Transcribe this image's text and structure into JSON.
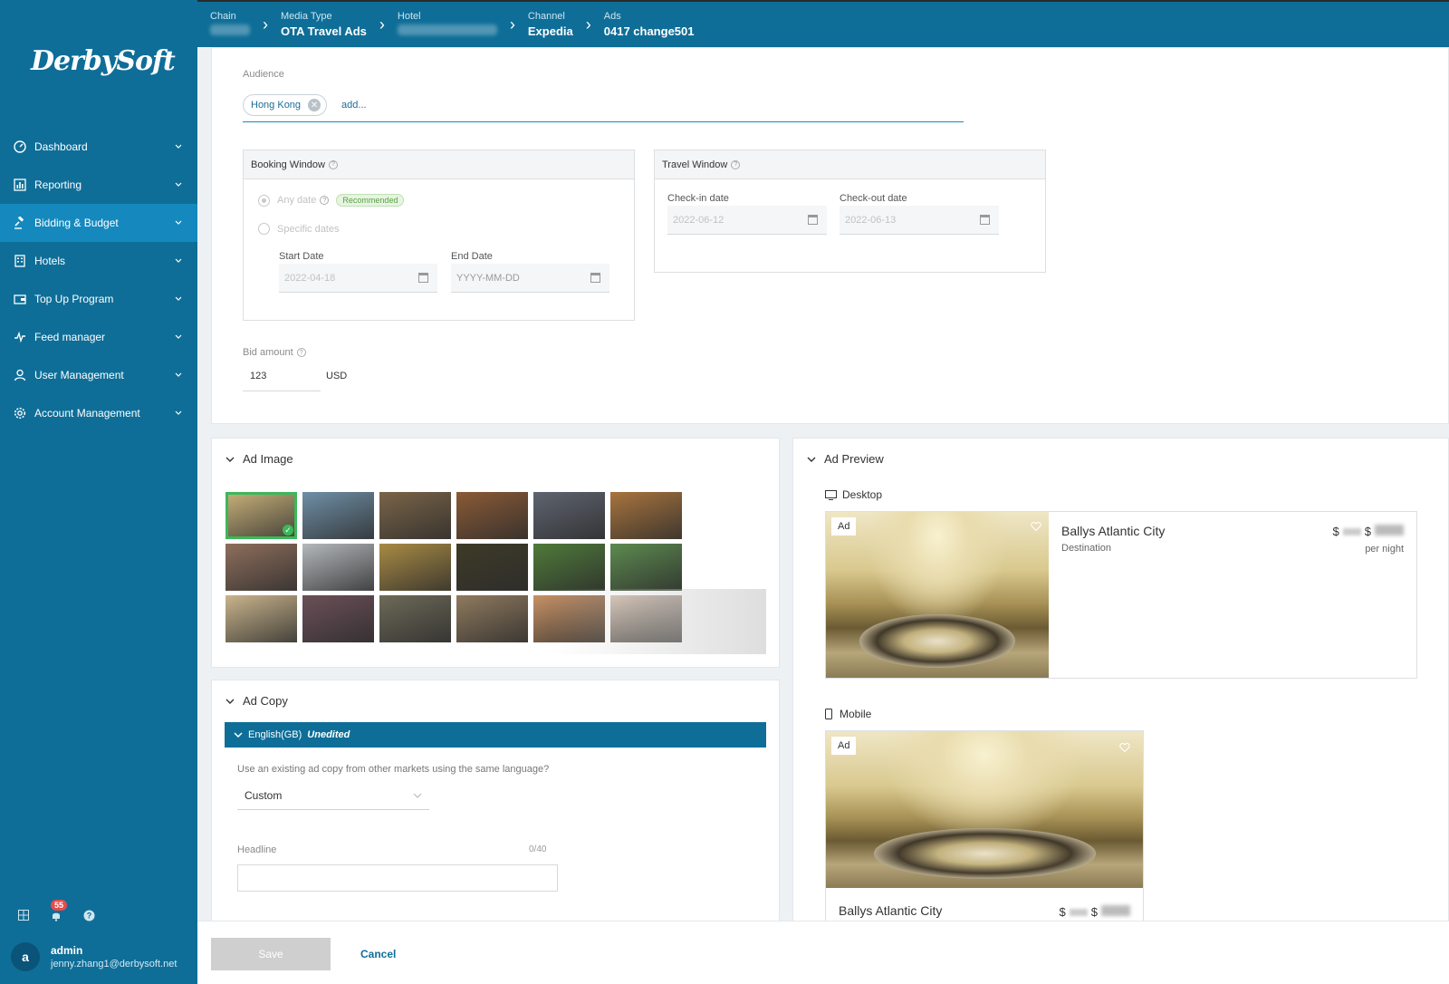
{
  "app": {
    "logo_text": "DerbySoft"
  },
  "sidebar": {
    "items": [
      {
        "label": "Dashboard",
        "icon": "dashboard-icon"
      },
      {
        "label": "Reporting",
        "icon": "chart-icon"
      },
      {
        "label": "Bidding & Budget",
        "icon": "gavel-icon",
        "active": true
      },
      {
        "label": "Hotels",
        "icon": "building-icon"
      },
      {
        "label": "Top Up Program",
        "icon": "wallet-icon"
      },
      {
        "label": "Feed manager",
        "icon": "pulse-icon"
      },
      {
        "label": "User Management",
        "icon": "user-icon"
      },
      {
        "label": "Account Management",
        "icon": "gear-icon"
      }
    ],
    "notification_count": "55",
    "user": {
      "initial": "a",
      "name": "admin",
      "email": "jenny.zhang1@derbysoft.net"
    }
  },
  "breadcrumb": [
    {
      "key": "Chain",
      "value": ""
    },
    {
      "key": "Media Type",
      "value": "OTA Travel Ads"
    },
    {
      "key": "Hotel",
      "value": ""
    },
    {
      "key": "Channel",
      "value": "Expedia"
    },
    {
      "key": "Ads",
      "value": "0417 change501"
    }
  ],
  "audience": {
    "label": "Audience",
    "chip": "Hong Kong",
    "add_placeholder": "add..."
  },
  "booking_window": {
    "title": "Booking Window",
    "any_date": "Any date",
    "recommended": "Recommended",
    "specific_dates": "Specific dates",
    "start_label": "Start Date",
    "start_value": "2022-04-18",
    "end_label": "End Date",
    "end_placeholder": "YYYY-MM-DD"
  },
  "travel_window": {
    "title": "Travel Window",
    "checkin_label": "Check-in date",
    "checkin_value": "2022-06-12",
    "checkout_label": "Check-out date",
    "checkout_value": "2022-06-13"
  },
  "bid": {
    "label": "Bid amount",
    "value": "123",
    "currency": "USD"
  },
  "ad_image": {
    "title": "Ad Image",
    "thumbnail_colors": [
      "#c9b27a",
      "#6f8fa6",
      "#7a6448",
      "#8a5a36",
      "#5f6470",
      "#a8743e",
      "#8e6e5c",
      "#b4b8bb",
      "#a88a44",
      "#3e3a28",
      "#4f7a3a",
      "#5d8a50",
      "#c9b48c",
      "#6b5058",
      "#6d6a58",
      "#8f7a5e",
      "#c79266",
      "#d8c6b6"
    ]
  },
  "ad_copy": {
    "title": "Ad Copy",
    "language": "English(GB)",
    "status": "Unedited",
    "question": "Use an existing ad copy from other markets using the same language?",
    "select_value": "Custom",
    "headline_label": "Headline",
    "headline_count": "0/40"
  },
  "ad_preview": {
    "title": "Ad Preview",
    "desktop_label": "Desktop",
    "mobile_label": "Mobile",
    "ad_tag": "Ad",
    "hotel_name": "Ballys Atlantic City",
    "destination": "Destination",
    "currency_symbol": "$",
    "per_night": "per night"
  },
  "footer": {
    "save_label": "Save",
    "cancel_label": "Cancel"
  }
}
